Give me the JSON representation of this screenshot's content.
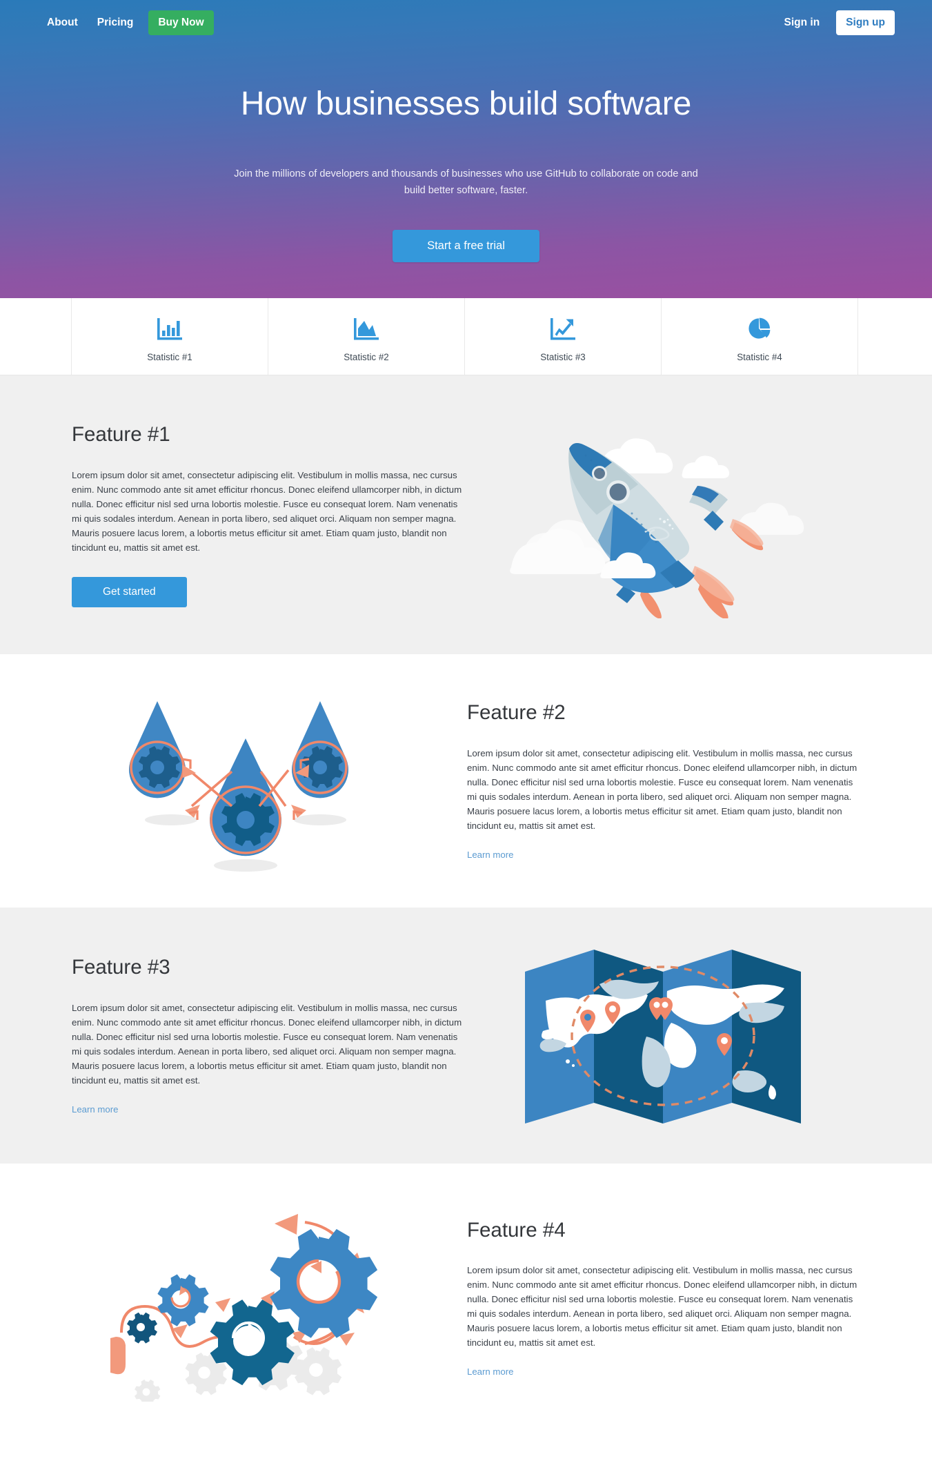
{
  "nav": {
    "links": [
      {
        "label": "About",
        "name": "nav-link-about"
      },
      {
        "label": "Pricing",
        "name": "nav-link-pricing"
      }
    ],
    "buy_label": "Buy Now",
    "signin_label": "Sign in",
    "signup_label": "Sign up",
    "buy_color": "#35ae60",
    "signup_text_color": "#2e7cc0"
  },
  "hero": {
    "title": "How businesses build software",
    "subtitle": "Join the millions of developers and thousands of businesses who use GitHub to collaborate on code and build better software, faster.",
    "cta_label": "Start a free trial",
    "cta_color": "#3498db",
    "gradient_from": "#2a7ab9",
    "gradient_to": "#9b4fa0"
  },
  "stats": {
    "items": [
      {
        "label": "Statistic #1",
        "icon": "bar-chart-icon"
      },
      {
        "label": "Statistic #2",
        "icon": "area-chart-icon"
      },
      {
        "label": "Statistic #3",
        "icon": "line-chart-up-icon"
      },
      {
        "label": "Statistic #4",
        "icon": "pie-chart-icon"
      }
    ],
    "icon_color": "#3498db"
  },
  "body_text": "Lorem ipsum dolor sit amet, consectetur adipiscing elit. Vestibulum in mollis massa, nec cursus enim. Nunc commodo ante sit amet efficitur rhoncus. Donec eleifend ullamcorper nibh, in dictum nulla. Donec efficitur nisl sed urna lobortis molestie. Fusce eu consequat lorem. Nam venenatis mi quis sodales interdum. Aenean in porta libero, sed aliquet orci. Aliquam non semper magna. Mauris posuere lacus lorem, a lobortis metus efficitur sit amet. Etiam quam justo, blandit non tincidunt eu, mattis sit amet est.",
  "features": [
    {
      "title": "Feature #1",
      "body": "Lorem ipsum dolor sit amet, consectetur adipiscing elit. Vestibulum in mollis massa, nec cursus enim. Nunc commodo ante sit amet efficitur rhoncus. Donec eleifend ullamcorper nibh, in dictum nulla. Donec efficitur nisl sed urna lobortis molestie. Fusce eu consequat lorem. Nam venenatis mi quis sodales interdum. Aenean in porta libero, sed aliquet orci. Aliquam non semper magna. Mauris posuere lacus lorem, a lobortis metus efficitur sit amet. Etiam quam justo, blandit non tincidunt eu, mattis sit amet est.",
      "action_label": "Get started",
      "action_type": "button",
      "illustration": "rocket-illustration",
      "background": "#f0f0f0",
      "text_side": "left"
    },
    {
      "title": "Feature #2",
      "body": "Lorem ipsum dolor sit amet, consectetur adipiscing elit. Vestibulum in mollis massa, nec cursus enim. Nunc commodo ante sit amet efficitur rhoncus. Donec eleifend ullamcorper nibh, in dictum nulla. Donec efficitur nisl sed urna lobortis molestie. Fusce eu consequat lorem. Nam venenatis mi quis sodales interdum. Aenean in porta libero, sed aliquet orci. Aliquam non semper magna. Mauris posuere lacus lorem, a lobortis metus efficitur sit amet. Etiam quam justo, blandit non tincidunt eu, mattis sit amet est.",
      "action_label": "Learn more",
      "action_type": "link",
      "illustration": "droplets-gears-illustration",
      "background": "#ffffff",
      "text_side": "right"
    },
    {
      "title": "Feature #3",
      "body": "Lorem ipsum dolor sit amet, consectetur adipiscing elit. Vestibulum in mollis massa, nec cursus enim. Nunc commodo ante sit amet efficitur rhoncus. Donec eleifend ullamcorper nibh, in dictum nulla. Donec efficitur nisl sed urna lobortis molestie. Fusce eu consequat lorem. Nam venenatis mi quis sodales interdum. Aenean in porta libero, sed aliquet orci. Aliquam non semper magna. Mauris posuere lacus lorem, a lobortis metus efficitur sit amet. Etiam quam justo, blandit non tincidunt eu, mattis sit amet est.",
      "action_label": "Learn more",
      "action_type": "link",
      "illustration": "world-map-illustration",
      "background": "#f0f0f0",
      "text_side": "left"
    },
    {
      "title": "Feature #4",
      "body": "Lorem ipsum dolor sit amet, consectetur adipiscing elit. Vestibulum in mollis massa, nec cursus enim. Nunc commodo ante sit amet efficitur rhoncus. Donec eleifend ullamcorper nibh, in dictum nulla. Donec efficitur nisl sed urna lobortis molestie. Fusce eu consequat lorem. Nam venenatis mi quis sodales interdum. Aenean in porta libero, sed aliquet orci. Aliquam non semper magna. Mauris posuere lacus lorem, a lobortis metus efficitur sit amet. Etiam quam justo, blandit non tincidunt eu, mattis sit amet est.",
      "action_label": "Learn more",
      "action_type": "link",
      "illustration": "gears-flow-illustration",
      "background": "#ffffff",
      "text_side": "right"
    }
  ],
  "palette": {
    "accent_blue": "#3498db",
    "deep_blue": "#1b6a99",
    "mid_blue": "#3d87c4",
    "orange": "#f08868",
    "link_blue": "#5b9bd1",
    "grey_bg": "#f0f0f0"
  }
}
